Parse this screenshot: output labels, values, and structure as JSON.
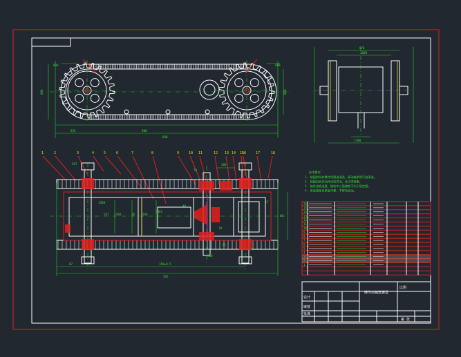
{
  "drawing": {
    "part_numbers": [
      "1",
      "2",
      "3",
      "4",
      "5",
      "6",
      "7",
      "8",
      "9",
      "10",
      "11",
      "12",
      "13",
      "14",
      "15",
      "16",
      "17",
      "18"
    ],
    "dims_top": [
      "880",
      "880",
      "535",
      "980",
      "600",
      "860",
      "700",
      "680"
    ],
    "dims_side": [
      "876",
      "1800",
      "1700"
    ],
    "dims_section": [
      "567",
      "1500",
      "547",
      "1700",
      "20",
      "560",
      "2001",
      "40",
      "200",
      "70",
      "45",
      "60",
      "340",
      "70",
      "85"
    ],
    "dims_bottom": [
      "67",
      "158±0.5",
      "565"
    ],
    "tech_notes_title": "技术要求",
    "tech_notes": [
      "1. 装配前所有零件用煤油清洗，滚动轴承用汽油清洗。",
      "2. 装配后各传动件运转灵活，无卡滞现象。",
      "3. 链条张紧适度，链轮中心面偏差不大于规定值。",
      "4. 各连接部位紧固可靠，不得有松动。"
    ],
    "title_block": {
      "project_name": "链传动输送装置",
      "label_design": "设计",
      "label_check": "审核",
      "label_approve": "批准",
      "label_scale": "比例",
      "label_sheet": "第 张"
    }
  }
}
